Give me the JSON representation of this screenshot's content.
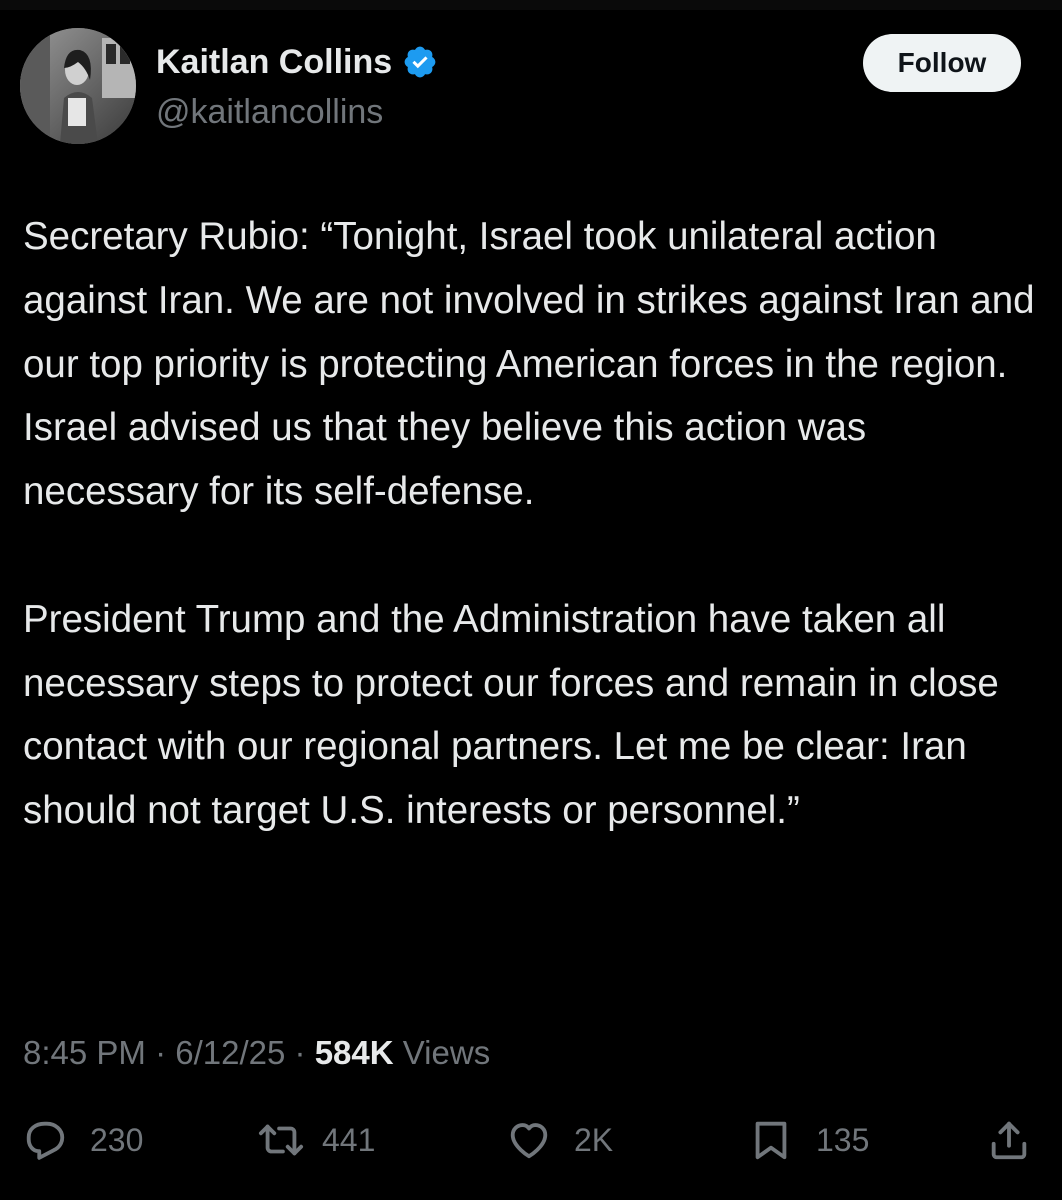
{
  "author": {
    "display_name": "Kaitlan Collins",
    "handle": "@kaitlancollins",
    "verified_color": "#1d9bf0"
  },
  "follow_label": "Follow",
  "tweet": {
    "paragraphs": [
      "Secretary Rubio: “Tonight, Israel took unilateral action against Iran. We are not involved in strikes against Iran and our top priority is protecting American forces in the region. Israel advised us that they believe this action was necessary for its self-defense.",
      "President Trump and the Administration have taken all necessary steps to protect our forces and remain in close contact with our regional partners. Let me be clear: Iran should not target U.S. interests or personnel.”"
    ]
  },
  "meta": {
    "time": "8:45 PM",
    "separator": "·",
    "date": "6/12/25",
    "views_count": "584K",
    "views_label": "Views"
  },
  "actions": {
    "replies": "230",
    "reposts": "441",
    "likes": "2K",
    "bookmarks": "135"
  },
  "icons": {
    "reply": "reply-icon",
    "repost": "repost-icon",
    "like": "heart-icon",
    "bookmark": "bookmark-icon",
    "share": "share-icon"
  },
  "colors": {
    "background": "#000000",
    "text": "#e7e9ea",
    "secondary": "#71767b",
    "follow_bg": "#eff3f4"
  }
}
